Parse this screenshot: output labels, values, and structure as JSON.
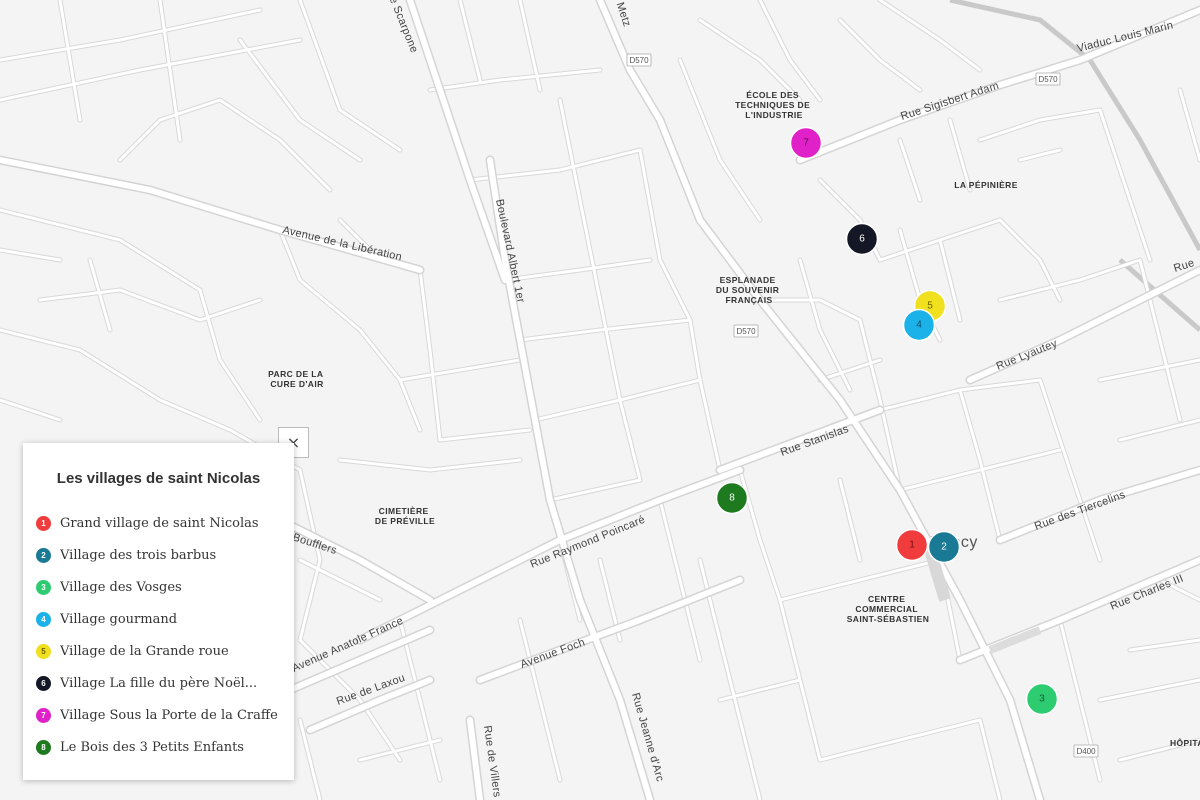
{
  "map": {
    "city_label": "Nancy",
    "streets": {
      "rue_de_metz": "Rue de Metz",
      "rue_scarpone": "Rue de Scarpone",
      "viaduc": "Viaduc Louis Marin",
      "sigisbert": "Rue Sigisbert Adam",
      "liberation": "Avenue de la Libération",
      "albert": "Boulevard Albert 1er",
      "stanislas": "Rue Stanislas",
      "poincare": "Rue Raymond Poincaré",
      "lyautey": "Rue Lyautey",
      "tiercelins": "Rue des Tiercelins",
      "charles": "Rue Charles III",
      "foch": "Avenue Foch",
      "anatole": "Avenue Anatole France",
      "laxou": "Rue de Laxou",
      "jeanne": "Rue Jeanne d'Arc",
      "villers": "Rue de Villers",
      "boufflers": "Boufflers",
      "right_edge": "Rue"
    },
    "areas": {
      "ecole": [
        "ÉCOLE DES",
        "TECHNIQUES DE",
        "L'INDUSTRIE"
      ],
      "pepiniere": "LA PÉPINIÈRE",
      "esplanade": [
        "ESPLANADE",
        "DU SOUVENIR",
        "FRANÇAIS"
      ],
      "parc": [
        "PARC DE LA",
        "CURE D'AIR"
      ],
      "cimetiere": [
        "CIMETIÈRE",
        "DE PRÉVILLE"
      ],
      "centre": [
        "CENTRE",
        "COMMERCIAL",
        "SAINT-SÉBASTIEN"
      ],
      "hopital": "HÔPITA"
    },
    "shields": {
      "d570_a": "D570",
      "d570_b": "D570",
      "d570_c": "D570",
      "d400": "D400"
    },
    "markers": [
      {
        "num": "1",
        "color": "#f03c3c",
        "text_color": "#7a1010"
      },
      {
        "num": "2",
        "color": "#1a7a96",
        "text_color": "#ffffff"
      },
      {
        "num": "3",
        "color": "#2ecc71",
        "text_color": "#145a30"
      },
      {
        "num": "4",
        "color": "#1ab2e8",
        "text_color": "#0b4a63"
      },
      {
        "num": "5",
        "color": "#f0e01e",
        "text_color": "#6b6200"
      },
      {
        "num": "6",
        "color": "#141826",
        "text_color": "#ffffff"
      },
      {
        "num": "7",
        "color": "#e020c8",
        "text_color": "#5a0a50"
      },
      {
        "num": "8",
        "color": "#1e7a1e",
        "text_color": "#ffffff"
      }
    ]
  },
  "legend": {
    "title": "Les villages de saint Nicolas",
    "close_symbol": "×",
    "items": [
      {
        "num": "1",
        "label": "Grand village de saint Nicolas",
        "color": "#f03c3c"
      },
      {
        "num": "2",
        "label": "Village des trois barbus",
        "color": "#1a7a96"
      },
      {
        "num": "3",
        "label": "Village des Vosges",
        "color": "#2ecc71"
      },
      {
        "num": "4",
        "label": "Village gourmand",
        "color": "#1ab2e8"
      },
      {
        "num": "5",
        "label": "Village de la Grande roue",
        "color": "#f0e01e"
      },
      {
        "num": "6",
        "label": "Village La fille du père Noël...",
        "color": "#141826"
      },
      {
        "num": "7",
        "label": "Village Sous la Porte de la Craffe",
        "color": "#e020c8"
      },
      {
        "num": "8",
        "label": "Le Bois des 3 Petits Enfants",
        "color": "#1e7a1e"
      }
    ]
  }
}
